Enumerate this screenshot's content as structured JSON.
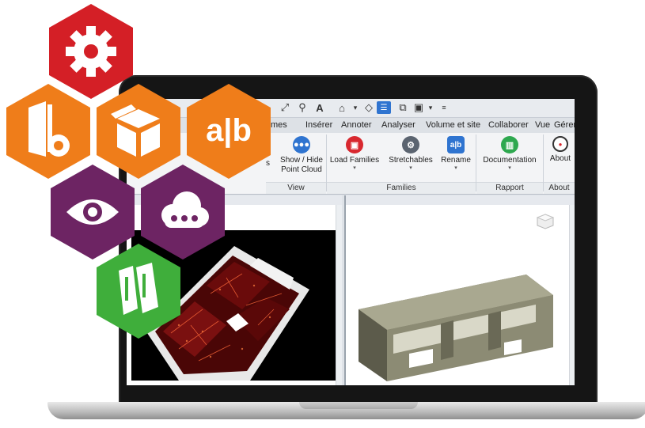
{
  "ribbon": {
    "tabs": [
      "mes",
      "Insérer",
      "Annoter",
      "Analyser",
      "Volume et site",
      "Collaborer",
      "Vue",
      "Gérer"
    ],
    "quick_access_label": "A",
    "buttons": {
      "show_hide": "Show / Hide",
      "show_hide_line2": "Point Cloud",
      "load_families": "Load Families",
      "stretchables": "Stretchables",
      "rename": "Rename",
      "rename_icon": "a|b",
      "documentation": "Documentation",
      "about": "About",
      "partial_left": "s"
    },
    "panels": {
      "view": "View",
      "families": "Families",
      "rapport": "Rapport",
      "about": "About"
    }
  },
  "hexagons": {
    "rename_text": "a|b"
  },
  "colors": {
    "hex_red": "#d41f26",
    "hex_orange": "#ef7d1a",
    "hex_purple": "#6d2463",
    "hex_green": "#3fae3b",
    "ribbon_blue": "#2f74d0",
    "ribbon_red": "#d8282f",
    "ribbon_gray": "#5b6470",
    "ribbon_green": "#2ea84f"
  }
}
